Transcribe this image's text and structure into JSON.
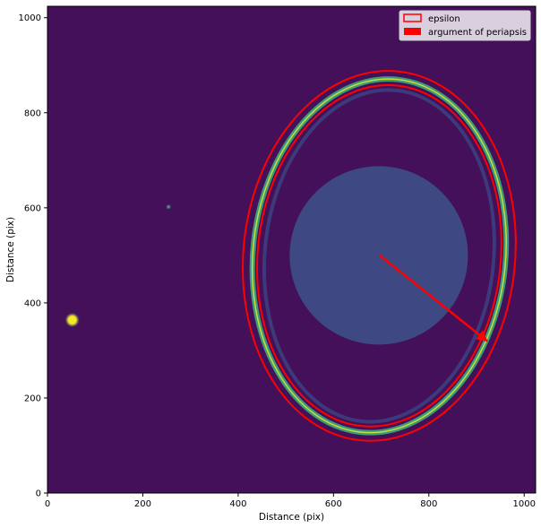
{
  "chart_data": {
    "type": "image",
    "xlabel": "Distance (pix)",
    "ylabel": "Distance (pix)",
    "xlim": [
      0,
      1024
    ],
    "ylim": [
      0,
      1024
    ],
    "xticks": [
      0,
      200,
      400,
      600,
      800,
      1000
    ],
    "yticks": [
      0,
      200,
      400,
      600,
      800,
      1000
    ],
    "grid": false,
    "legend_position": "top-right",
    "colormap": "viridis",
    "background_color": "#44105a",
    "features": {
      "ring": {
        "cx": 696,
        "cy": 499,
        "rx": 265,
        "ry": 373,
        "rotation_deg": 6,
        "color": "#3ab57a",
        "highlight": "#dde03a"
      },
      "inner_ring": {
        "cx": 696,
        "cy": 499,
        "rx": 240,
        "ry": 350,
        "rotation_deg": 6,
        "color": "#3a4d8a"
      },
      "disk": {
        "cx": 695,
        "cy": 500,
        "r": 187,
        "color": "#3d548c"
      },
      "bright_spot": {
        "x": 52,
        "y": 364,
        "color": "#f5e626"
      },
      "faint_spot": {
        "x": 254,
        "y": 602,
        "color": "#3ec0a0"
      }
    },
    "series": [
      {
        "name": "epsilon",
        "kind": "ellipse-bounds",
        "color": "#ff0000",
        "ellipses": [
          {
            "cx": 696,
            "cy": 499,
            "rx": 285,
            "ry": 390,
            "rotation_deg": 6
          },
          {
            "cx": 696,
            "cy": 499,
            "rx": 255,
            "ry": 360,
            "rotation_deg": 6
          }
        ]
      },
      {
        "name": "argument of periapsis",
        "kind": "arrow",
        "color": "#ff0000",
        "start": [
          697,
          500
        ],
        "end": [
          922,
          320
        ]
      }
    ]
  }
}
